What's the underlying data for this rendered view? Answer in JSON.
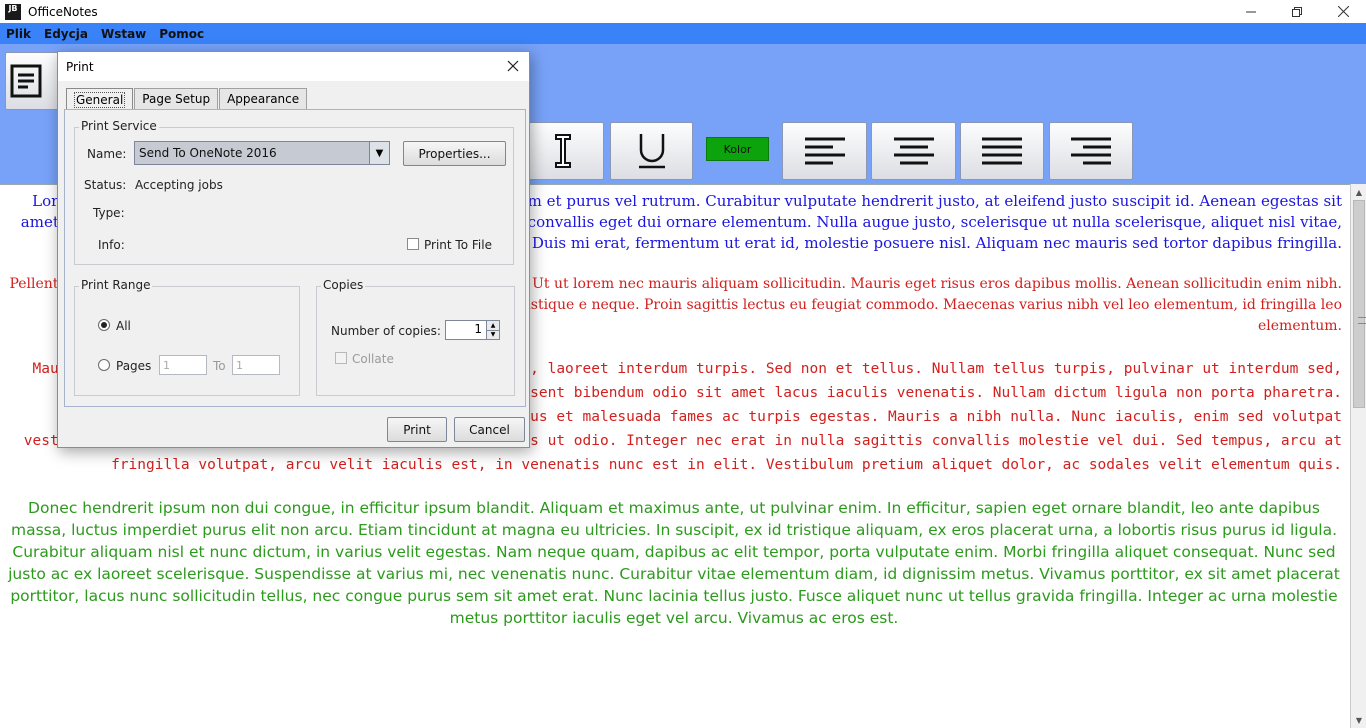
{
  "window": {
    "title": "OfficeNotes",
    "icon_text": "JB",
    "controls": [
      "minimize-icon",
      "restore-icon",
      "close-icon"
    ]
  },
  "menu": {
    "items": [
      "Plik",
      "Edycja",
      "Wstaw",
      "Pomoc"
    ]
  },
  "toolbar": {
    "kolor_label": "Kolor",
    "colors": {
      "toolbar_bg": "#78a2f8",
      "menubar_bg": "#3a82f7",
      "kolor_bg": "#0da30c"
    }
  },
  "editor": {
    "paragraphs": [
      {
        "color": "#1b15e0",
        "text": "Lorem ipsum dolor sit amet, consectetur adipiscing elit. Etiam ium et purus vel rutrum. Curabitur vulputate hendrerit justo, at eleifend justo suscipit id. Aenean egestas sit amet nisi eu ornare. Vivamus dignissim mi vel iaculis molestie. Ut convallis eget dui ornare elementum. Nulla augue justo, scelerisque ut nulla scelerisque, aliquet nisl vitae, aliquet nulla. Aliquam posuere mollis dapibus. Duis mi erat, fermentum ut erat id, molestie posuere nisl. Aliquam nec mauris sed tortor dapibus fringilla."
      },
      {
        "color": "#d2201e",
        "text": "Pellentesque sed eleifend ex metus, rhoncus pharetra augue placerat ac. Ut ut lorem nec mauris aliquam sollicitudin. Mauris eget risus eros dapibus mollis. Aenean sollicitudin enim nibh. In porttitor mi nec mattis posuere. Pellentesque habitant morbi tristique e neque. Proin sagittis lectus eu feugiat commodo. Maecenas varius nibh vel leo elementum, id fringilla leo elementum."
      },
      {
        "color": "#d2201e",
        "text": "Mauris is diam. Vivamus ipsum felis, faucibus id neque id, laoreet interdum turpis. Sed non et tellus. Nullam tellus turpis, pulvinar ut interdum sed, imperdiet nec ligula. Mauris vel mauris lacus. Praesent bibendum odio sit amet lacus iaculis venenatis. Nullam dictum ligula non porta pharetra. Pellentesque habitant morbi tristique senectus et netus et malesuada fames ac turpis egestas. Mauris a nibh nulla. Nunc iaculis, enim sed volutpat vestibulum, diam odio viverra ipsum, vitae euismod mi risus ut odio. Integer nec erat in nulla sagittis convallis molestie vel dui. Sed tempus, arcu at fringilla volutpat, arcu velit iaculis est, in venenatis nunc est in elit. Vestibulum pretium aliquet dolor, ac sodales velit elementum quis."
      },
      {
        "color": "#2c9a1c",
        "text": "Donec hendrerit ipsum non dui congue, in efficitur ipsum blandit. Aliquam et maximus ante, ut pulvinar enim. In efficitur, sapien eget ornare blandit, leo ante dapibus massa, luctus imperdiet purus elit non arcu. Etiam tincidunt at magna eu ultricies. In suscipit, ex id tristique aliquam, ex eros placerat urna, a lobortis risus purus id ligula. Curabitur aliquam nisl et nunc dictum, in varius velit egestas. Nam neque quam, dapibus ac elit tempor, porta vulputate enim. Morbi fringilla aliquet consequat. Nunc sed justo ac ex laoreet scelerisque. Suspendisse at varius mi, nec venenatis nunc. Curabitur vitae elementum diam, id dignissim metus. Vivamus porttitor, ex sit amet placerat porttitor, lacus nunc sollicitudin tellus, nec congue purus sem sit amet erat. Nunc lacinia tellus justo. Fusce aliquet nunc ut tellus gravida fringilla. Integer ac urna molestie metus porttitor iaculis eget vel arcu. Vivamus ac eros est."
      }
    ]
  },
  "dialog": {
    "title": "Print",
    "tabs": [
      "General",
      "Page Setup",
      "Appearance"
    ],
    "active_tab": "General",
    "print_service": {
      "group_label": "Print Service",
      "name_label": "Name:",
      "name_value": "Send To OneNote 2016",
      "properties_button": "Properties...",
      "status_label": "Status:",
      "status_value": "Accepting jobs",
      "type_label": "Type:",
      "info_label": "Info:",
      "print_to_file_label": "Print To File",
      "print_to_file_checked": false
    },
    "print_range": {
      "group_label": "Print Range",
      "all_label": "All",
      "pages_label": "Pages",
      "selected": "All",
      "from_value": "1",
      "to_label": "To",
      "to_value": "1"
    },
    "copies": {
      "group_label": "Copies",
      "number_label": "Number of copies:",
      "number_value": "1",
      "collate_label": "Collate",
      "collate_checked": false
    },
    "print_button": "Print",
    "cancel_button": "Cancel"
  }
}
